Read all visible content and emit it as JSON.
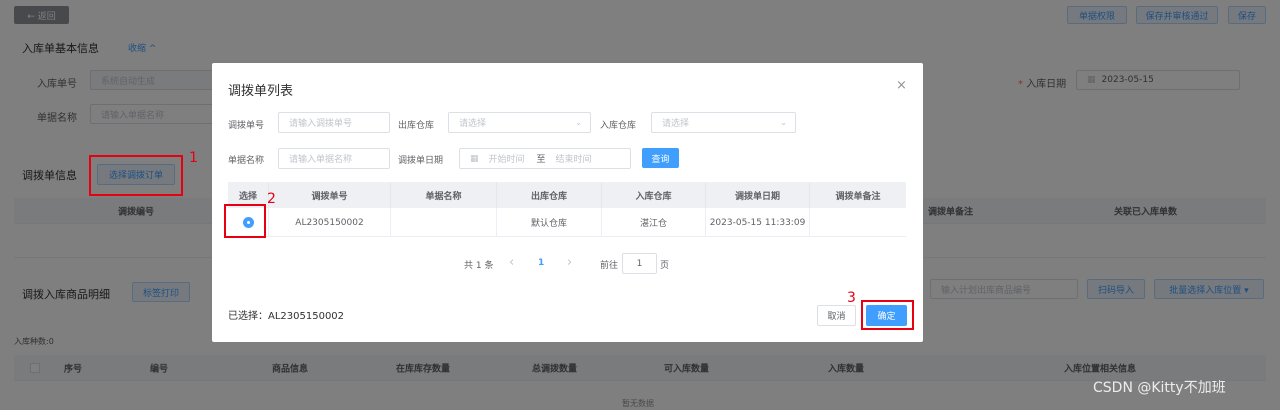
{
  "topbar": {
    "back_label": "← 返回",
    "doc_perm_label": "单据权限",
    "save_audit_label": "保存并审核通过",
    "save_label": "保存"
  },
  "basic_info": {
    "title": "入库单基本信息",
    "collapse_label": "收缩 ^",
    "inbound_no_label": "入库单号",
    "inbound_no_placeholder": "系统自动生成",
    "doc_name_label": "单据名称",
    "doc_name_placeholder": "请输入单据名称",
    "inbound_date_label": "入库日期",
    "inbound_date_value": "2023-05-15"
  },
  "transfer_info": {
    "title": "调拨单信息",
    "select_button": "选择调拨订单",
    "columns": {
      "transfer_no": "调拨编号",
      "remark": "调拨单备注",
      "linked_qty": "关联已入库单数"
    }
  },
  "goods_detail": {
    "title": "调拨入库商品明细",
    "print_button": "标签打印",
    "plan_search_placeholder": "输入计划出库商品编号",
    "scan_import_button": "扫码导入",
    "batch_select_button": "批量选择入库位置 ▾",
    "item_count": "入库种数:0",
    "columns": [
      "序号",
      "编号",
      "商品信息",
      "在库库存数量",
      "总调拨数量",
      "可入库数量",
      "入库数量",
      "入库位置相关信息"
    ],
    "empty_text": "暂无数据"
  },
  "dialog": {
    "title": "调拨单列表",
    "close_icon": "×",
    "filters": {
      "transfer_no_label": "调拨单号",
      "transfer_no_placeholder": "请输入调拨单号",
      "out_wh_label": "出库仓库",
      "out_wh_placeholder": "请选择",
      "in_wh_label": "入库仓库",
      "in_wh_placeholder": "请选择",
      "doc_name_label": "单据名称",
      "doc_name_placeholder": "请输入单据名称",
      "transfer_date_label": "调拨单日期",
      "start_placeholder": "开始时间",
      "range_sep": "至",
      "end_placeholder": "结束时间",
      "query_button": "查询"
    },
    "table": {
      "headers": [
        "选择",
        "调拨单号",
        "单据名称",
        "出库仓库",
        "入库仓库",
        "调拨单日期",
        "调拨单备注"
      ],
      "rows": [
        {
          "transfer_no": "AL2305150002",
          "doc_name": "",
          "out_wh": "默认仓库",
          "in_wh": "湛江仓",
          "date": "2023-05-15 11:33:09",
          "remark": ""
        }
      ]
    },
    "pagination": {
      "total": "共 1 条",
      "prev": "‹",
      "page": "1",
      "next": "›",
      "goto_label": "前往",
      "goto_value": "1",
      "page_unit": "页"
    },
    "selected_text": "已选择：AL2305150002",
    "cancel_button": "取消",
    "confirm_button": "确定"
  },
  "annotations": {
    "n1": "1",
    "n2": "2",
    "n3": "3"
  },
  "watermark": "CSDN @Kitty不加班",
  "colors": {
    "primary": "#409eff",
    "annotation_red": "#e60012"
  }
}
